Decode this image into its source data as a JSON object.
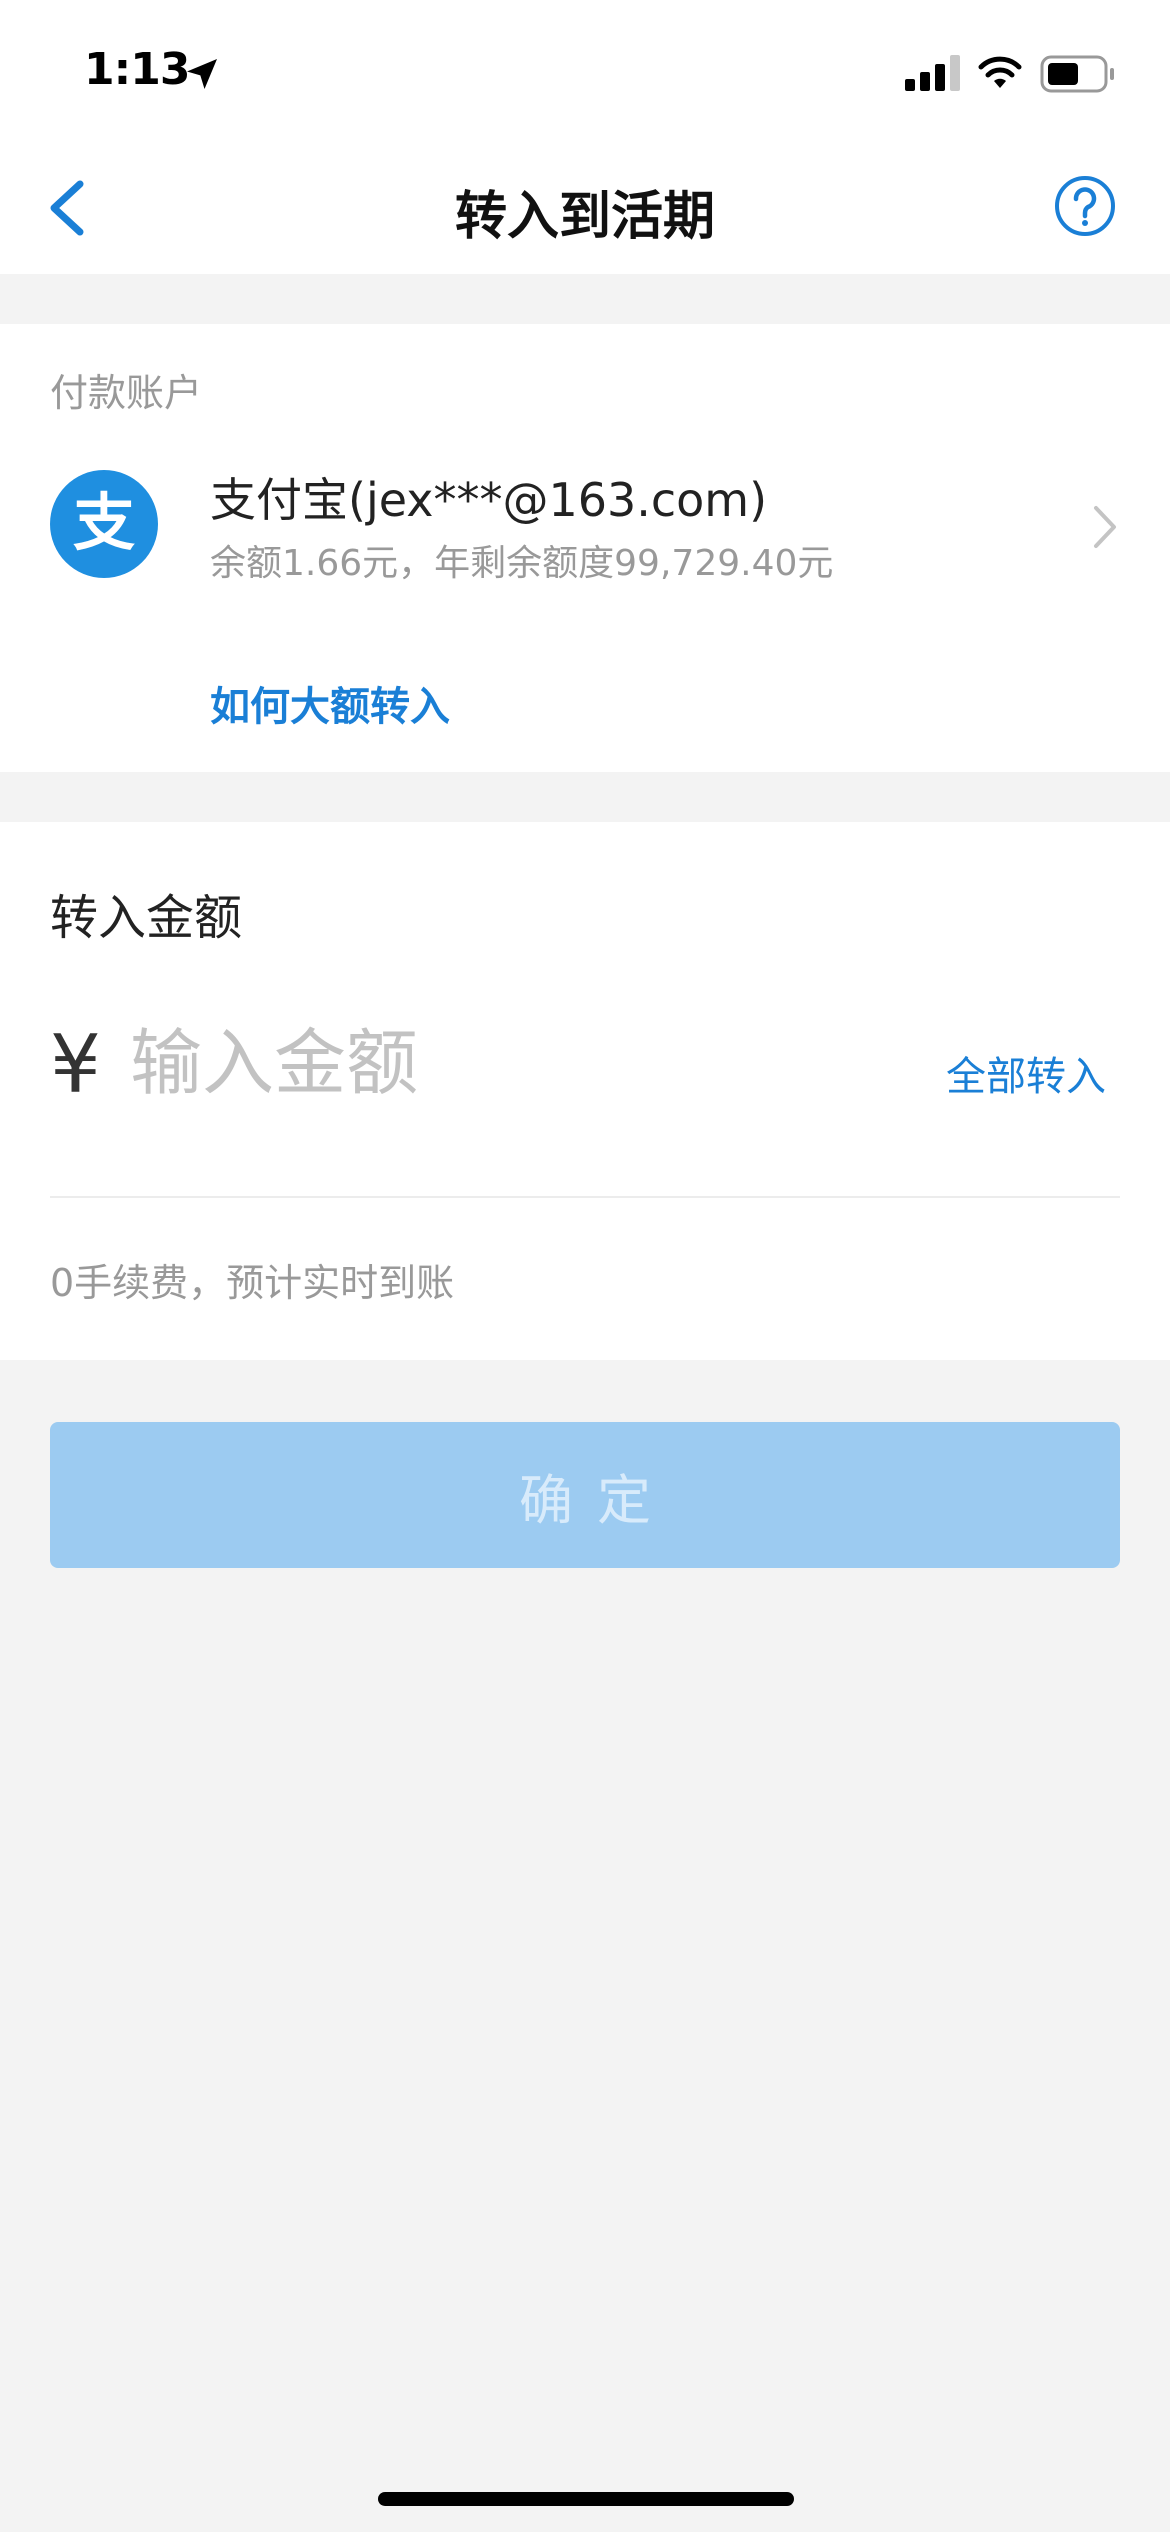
{
  "status_bar": {
    "time": "1:13",
    "icons": [
      "location-arrow-icon",
      "cellular-signal-icon",
      "wifi-icon",
      "battery-icon"
    ]
  },
  "nav": {
    "title": "转入到活期",
    "back_icon": "chevron-left-icon",
    "help_icon": "question-circle-icon"
  },
  "payment_account": {
    "section_label": "付款账户",
    "logo_icon": "alipay-logo-icon",
    "logo_glyph": "支",
    "account_name": "支付宝(jex***@163.com)",
    "balance_text": "余额1.66元，年剩余额度99,729.40元",
    "large_transfer_link": "如何大额转入"
  },
  "amount": {
    "label": "转入金额",
    "currency_symbol": "¥",
    "placeholder": "输入金额",
    "value": "",
    "transfer_all_label": "全部转入",
    "fee_note": "0手续费，预计实时到账"
  },
  "confirm": {
    "label": "确定"
  },
  "colors": {
    "accent": "#1a7fd6",
    "disabled_button": "#9ccbf1",
    "page_background": "#f3f3f3"
  }
}
